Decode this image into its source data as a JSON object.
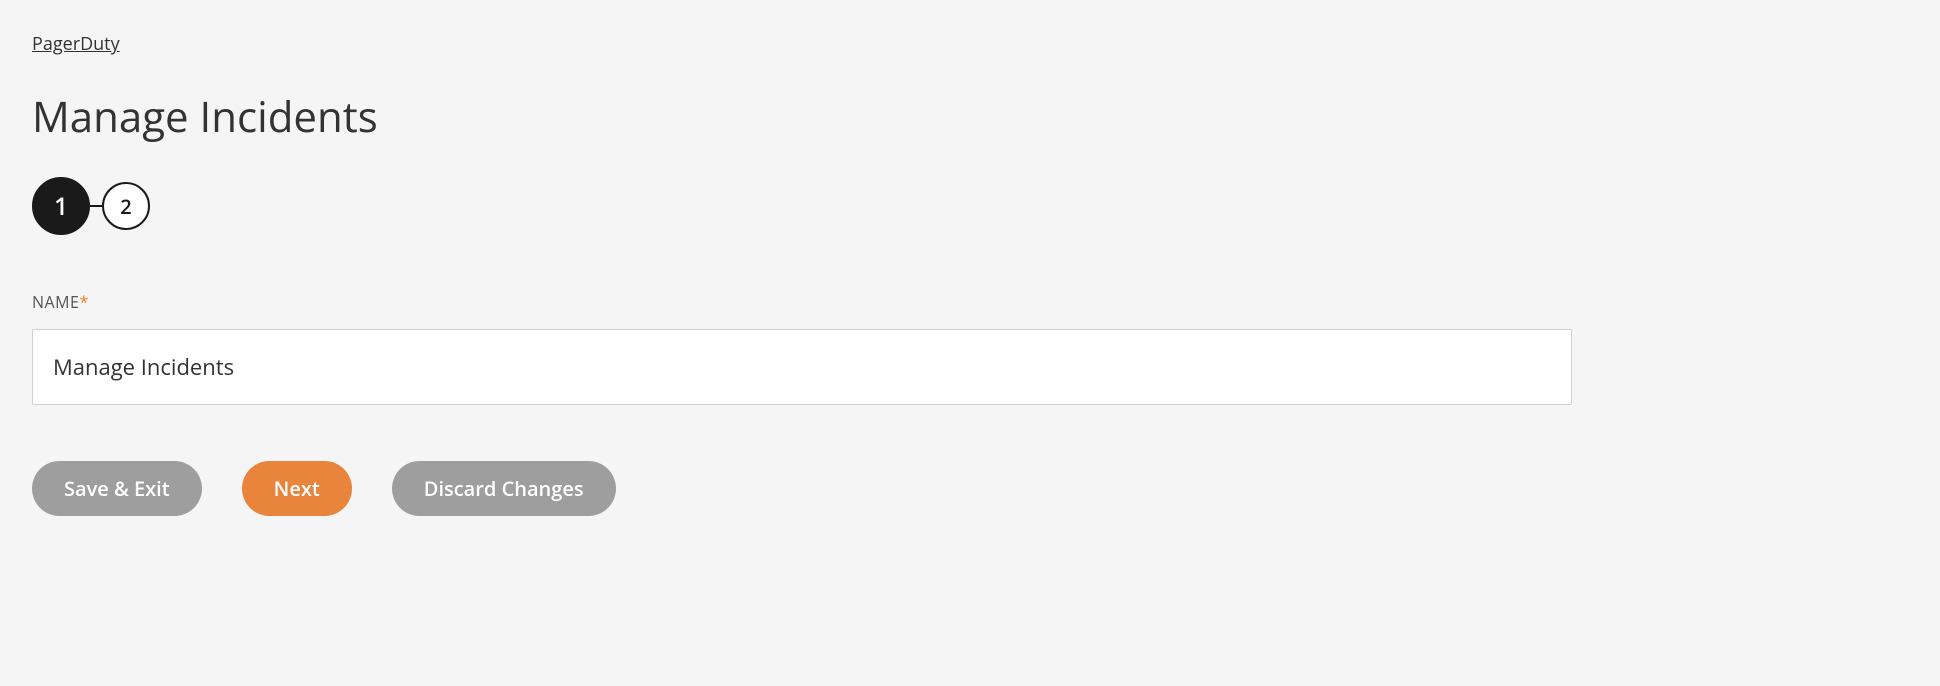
{
  "breadcrumb": {
    "parent": "PagerDuty"
  },
  "page": {
    "title": "Manage Incidents"
  },
  "stepper": {
    "steps": [
      {
        "label": "1",
        "active": true
      },
      {
        "label": "2",
        "active": false
      }
    ]
  },
  "form": {
    "name_label": "NAME",
    "name_value": "Manage Incidents"
  },
  "buttons": {
    "save_exit": "Save & Exit",
    "next": "Next",
    "discard": "Discard Changes"
  }
}
